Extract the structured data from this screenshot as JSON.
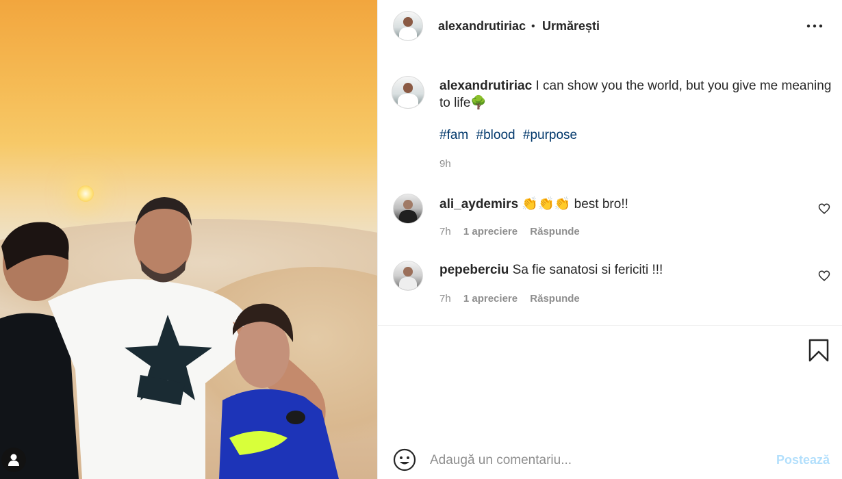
{
  "post": {
    "photo_alt": "Post photo",
    "author": "alexandrutiriac",
    "header_separator": "•",
    "follow_state": "Urmărești",
    "caption": {
      "username": "alexandrutiriac",
      "text": "I can show you the world, but you give me meaning to life🌳",
      "hashtags": [
        "#fam",
        "#blood",
        "#purpose"
      ],
      "time": "9h"
    }
  },
  "comments": [
    {
      "username": "ali_aydemirs",
      "text": "👏👏👏 best bro!!",
      "time": "7h",
      "likes": "1 apreciere",
      "reply": "Răspunde"
    },
    {
      "username": "pepeberciu",
      "text": "Sa fie sanatosi si fericiti !!!",
      "time": "7h",
      "likes": "1 apreciere",
      "reply": "Răspunde"
    }
  ],
  "composer": {
    "placeholder": "Adaugă un comentariu...",
    "post_label": "Postează"
  },
  "icons": {
    "more": "more-options-icon",
    "heart": "heart-icon",
    "bookmark": "bookmark-icon",
    "emoji": "smiley-icon",
    "user": "person-user-icon"
  },
  "colors": {
    "link": "#00376b",
    "muted": "#8e8e8e",
    "post_disabled": "#b2dffc"
  }
}
